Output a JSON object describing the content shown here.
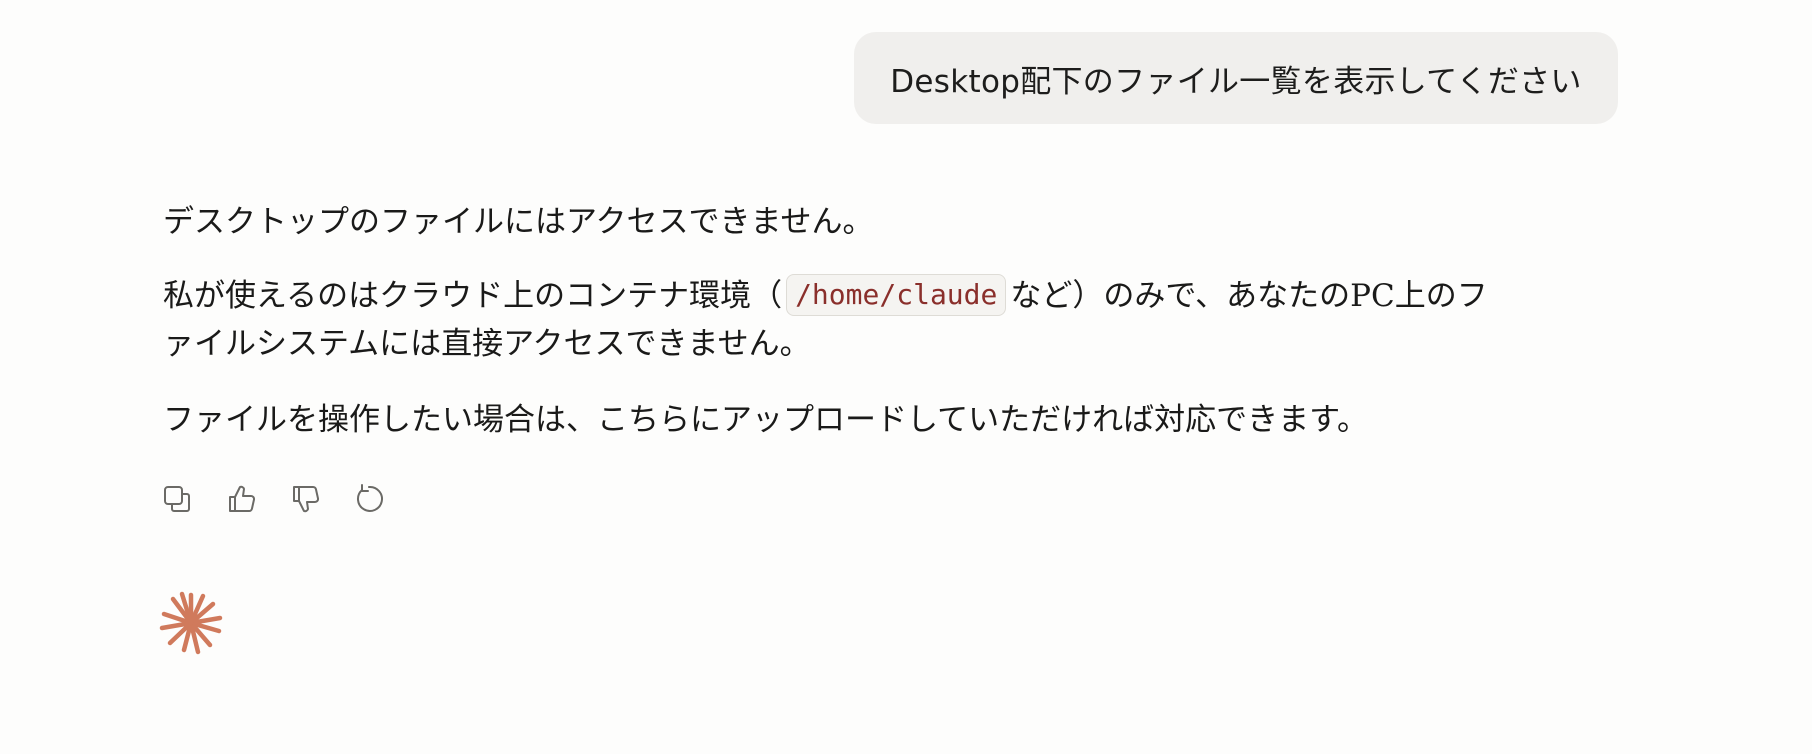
{
  "user_message": {
    "text": "Desktop配下のファイル一覧を表示してください"
  },
  "assistant_message": {
    "p1": "デスクトップのファイルにはアクセスできません。",
    "p2_before": "私が使えるのはクラウド上のコンテナ環境（",
    "p2_code": "/home/claude",
    "p2_after": "など）のみで、あなたのPC上のフ",
    "p2_line2": "ァイルシステムには直接アクセスできません。",
    "p3": "ファイルを操作したい場合は、こちらにアップロードしていただければ対応できます。"
  },
  "actions": [
    {
      "icon": "copy-icon"
    },
    {
      "icon": "thumbs-up-icon"
    },
    {
      "icon": "thumbs-down-icon"
    },
    {
      "icon": "retry-icon"
    }
  ],
  "colors": {
    "background": "#fdfdfc",
    "user_bubble": "#f0efed",
    "code_text": "#8a2f2b",
    "spark": "#d07a5c",
    "icon": "#6b6a66"
  }
}
